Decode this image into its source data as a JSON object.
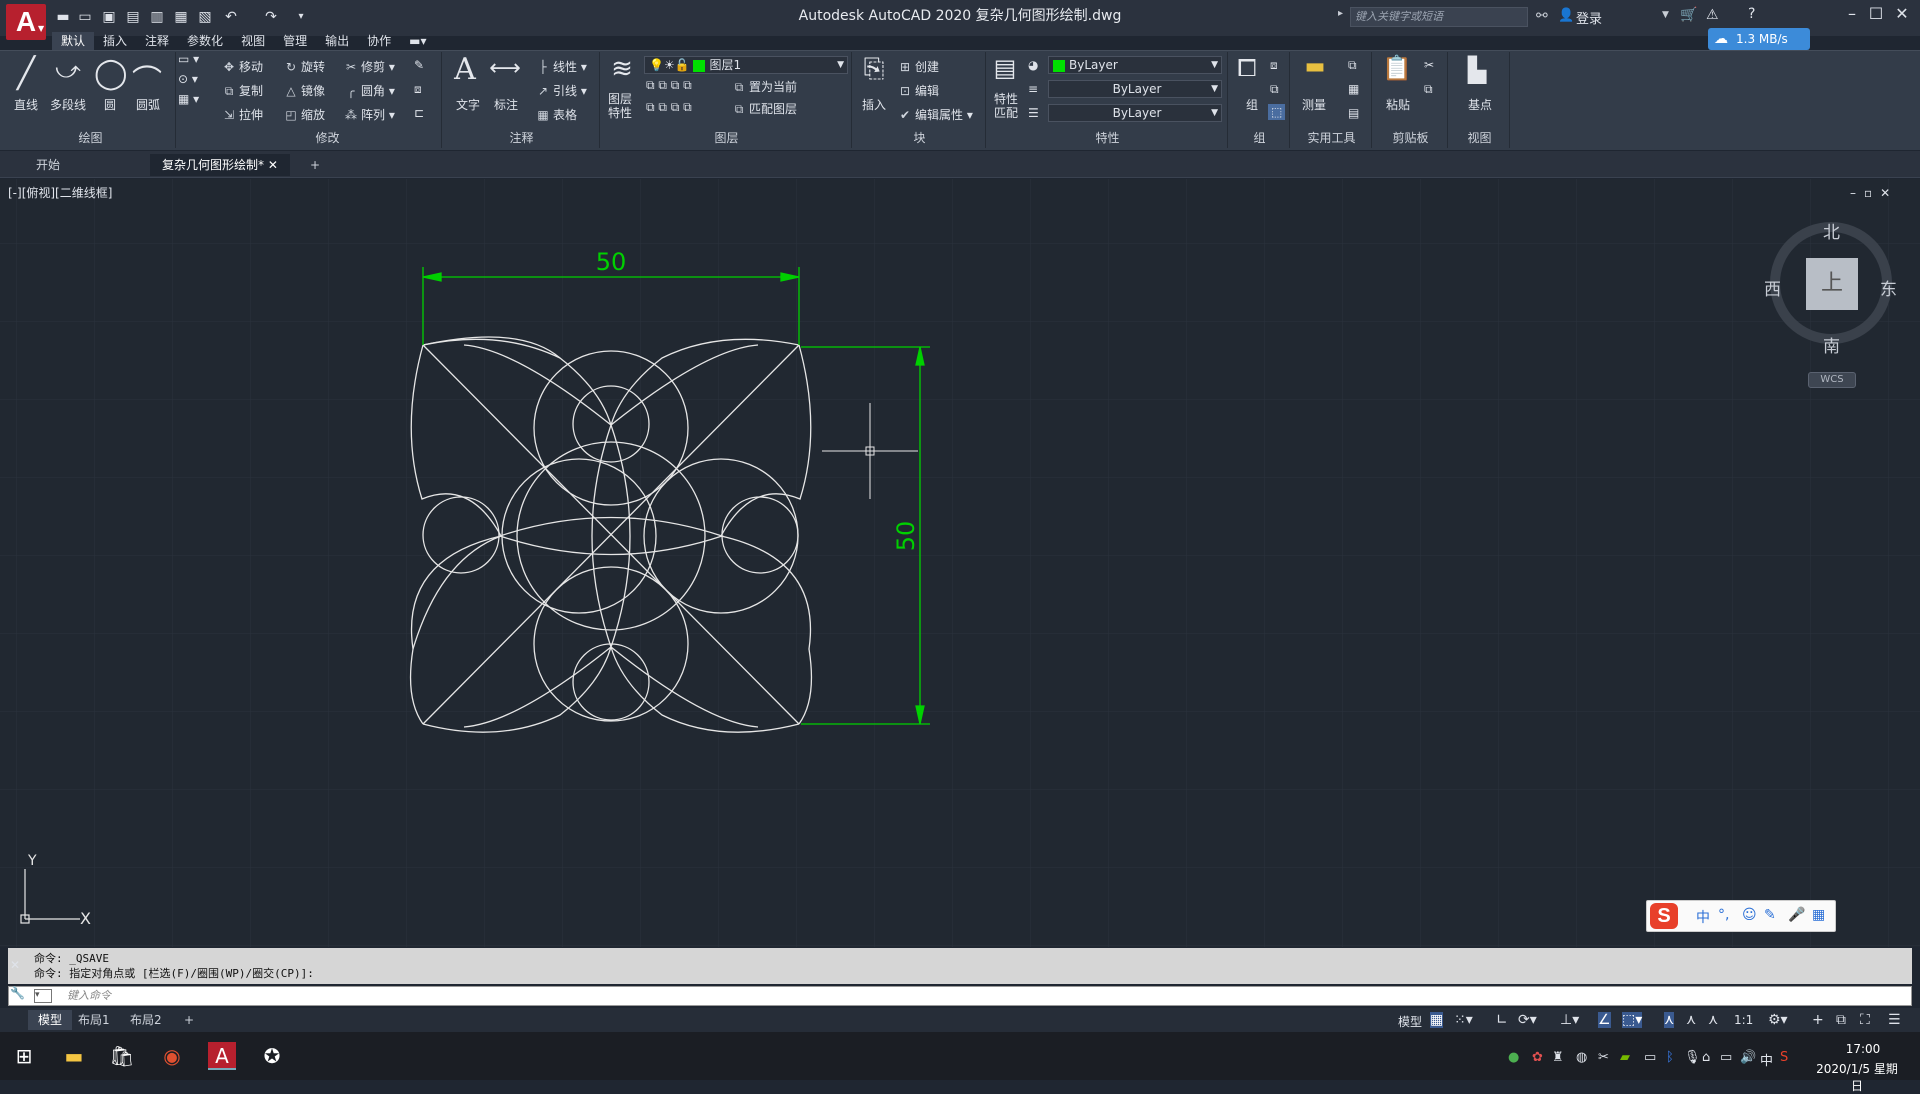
{
  "titlebar": {
    "app_logo": "A",
    "title": "Autodesk AutoCAD 2020    复杂几何图形绘制.dwg",
    "search_placeholder": "键入关键字或短语",
    "login": "登录",
    "net_speed": "1.3 MB/s"
  },
  "menu_tabs": [
    "默认",
    "插入",
    "注释",
    "参数化",
    "视图",
    "管理",
    "输出",
    "协作"
  ],
  "ribbon": {
    "draw": {
      "title": "绘图",
      "line": "直线",
      "polyline": "多段线",
      "circle": "圆",
      "arc": "圆弧"
    },
    "modify": {
      "title": "修改",
      "move": "移动",
      "rotate": "旋转",
      "trim": "修剪",
      "copy": "复制",
      "mirror": "镜像",
      "fillet": "圆角",
      "stretch": "拉伸",
      "scale": "缩放",
      "array": "阵列"
    },
    "annotation": {
      "title": "注释",
      "text": "文字",
      "dimension": "标注",
      "linear": "线性",
      "leader": "引线",
      "table": "表格"
    },
    "layers": {
      "title": "图层",
      "layer_props": "图层\n特性",
      "layer_name": "图层1",
      "set_current": "置为当前",
      "match_layer": "匹配图层"
    },
    "block": {
      "title": "块",
      "insert": "插入",
      "create": "创建",
      "edit": "编辑",
      "edit_attr": "编辑属性"
    },
    "properties": {
      "title": "特性",
      "match": "特性\n匹配",
      "color": "ByLayer",
      "linetype": "ByLayer",
      "lineweight": "ByLayer"
    },
    "groups": {
      "title": "组",
      "group": "组"
    },
    "utilities": {
      "title": "实用工具",
      "measure": "测量"
    },
    "clipboard": {
      "title": "剪贴板",
      "paste": "粘贴"
    },
    "view": {
      "title": "视图",
      "base": "基点"
    }
  },
  "doc_tabs": {
    "start": "开始",
    "active": "复杂几何图形绘制*"
  },
  "viewport": {
    "label": "[-][俯视][二维线框]",
    "dim_horizontal": "50",
    "dim_vertical": "50",
    "ucs_x": "X",
    "ucs_y": "Y"
  },
  "viewcube": {
    "north": "北",
    "south": "南",
    "east": "东",
    "west": "西",
    "face": "上",
    "wcs": "WCS"
  },
  "command": {
    "line1": "命令: _QSAVE",
    "line2": "命令: 指定对角点或 [栏选(F)/圈围(WP)/圈交(CP)]:",
    "input_placeholder": "键入命令"
  },
  "layout_tabs": [
    "模型",
    "布局1",
    "布局2"
  ],
  "status": {
    "model": "模型",
    "scale": "1:1"
  },
  "ime": {
    "lang": "中"
  },
  "tray": {
    "lang": "中",
    "time": "17:00",
    "date": "2020/1/5 星期日"
  },
  "colors": {
    "accent_green": "#00d000",
    "background": "#212831",
    "ribbon": "#333c49",
    "logo_red": "#b7202e"
  }
}
